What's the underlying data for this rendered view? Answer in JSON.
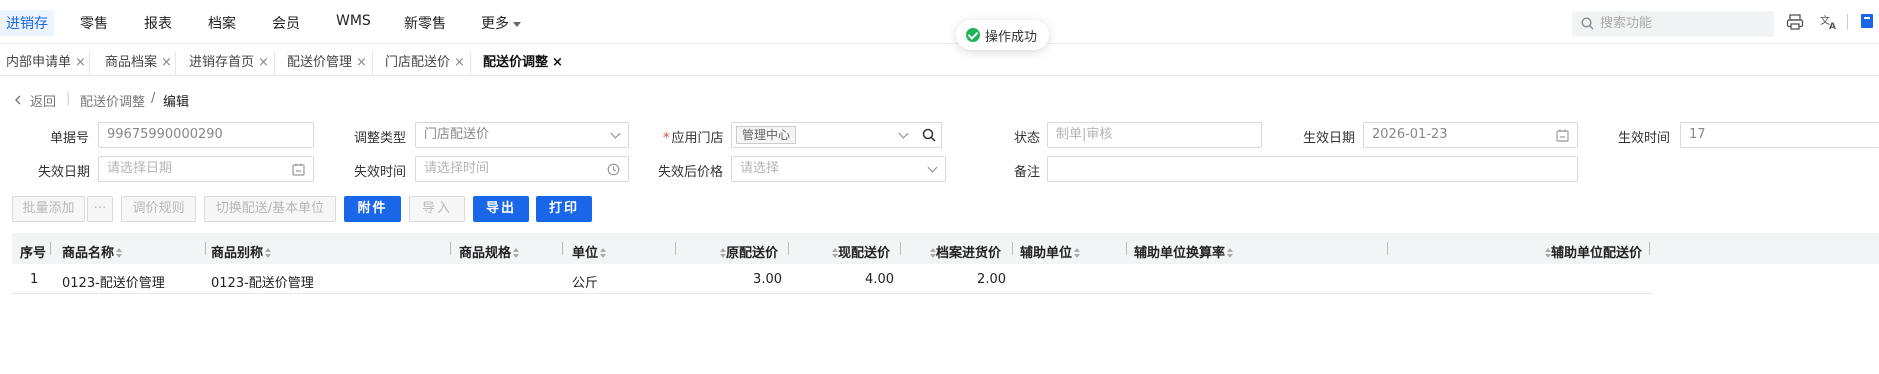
{
  "topnav": {
    "items": [
      "进销存",
      "零售",
      "报表",
      "档案",
      "会员",
      "WMS",
      "新零售",
      "更多"
    ],
    "search_placeholder": "搜索功能"
  },
  "toast": {
    "message": "操作成功"
  },
  "tabs": [
    {
      "label": "内部申请单",
      "close": "×"
    },
    {
      "label": "商品档案",
      "close": "×"
    },
    {
      "label": "进销存首页",
      "close": "×"
    },
    {
      "label": "配送价管理",
      "close": "×"
    },
    {
      "label": "门店配送价",
      "close": "×"
    },
    {
      "label": "配送价调整",
      "close": "×"
    }
  ],
  "breadcrumb": {
    "back": "返回",
    "parent": "配送价调整",
    "separator": "/",
    "current": "编辑"
  },
  "form": {
    "doc_no_label": "单据号",
    "doc_no_value": "99675990000290",
    "adjust_type_label": "调整类型",
    "adjust_type_value": "门店配送价",
    "store_label": "应用门店",
    "store_tag": "管理中心",
    "status_label": "状态",
    "status_value": "制单|审核",
    "effective_date_label": "生效日期",
    "effective_date_value": "2026-01-23",
    "effective_time_label": "生效时间",
    "effective_time_value": "17",
    "expire_date_label": "失效日期",
    "expire_date_placeholder": "请选择日期",
    "expire_time_label": "失效时间",
    "expire_time_placeholder": "请选择时间",
    "after_price_label": "失效后价格",
    "after_price_placeholder": "请选择",
    "remark_label": "备注"
  },
  "toolbar": {
    "batch_add": "批量添加",
    "more": "···",
    "price_rule": "调价规则",
    "switch_unit": "切换配送/基本单位",
    "attach": "附件",
    "import": "导入",
    "export": "导出",
    "print": "打印"
  },
  "table": {
    "headers": [
      "序号",
      "商品名称",
      "商品别称",
      "商品规格",
      "单位",
      "原配送价",
      "现配送价",
      "档案进货价",
      "辅助单位",
      "辅助单位换算率",
      "辅助单位配送价"
    ],
    "rows": [
      {
        "seq": "1",
        "name": "0123-配送价管理",
        "alias": "0123-配送价管理",
        "spec": "",
        "unit": "公斤",
        "orig_price": "3.00",
        "new_price": "4.00",
        "file_price": "2.00"
      }
    ]
  }
}
